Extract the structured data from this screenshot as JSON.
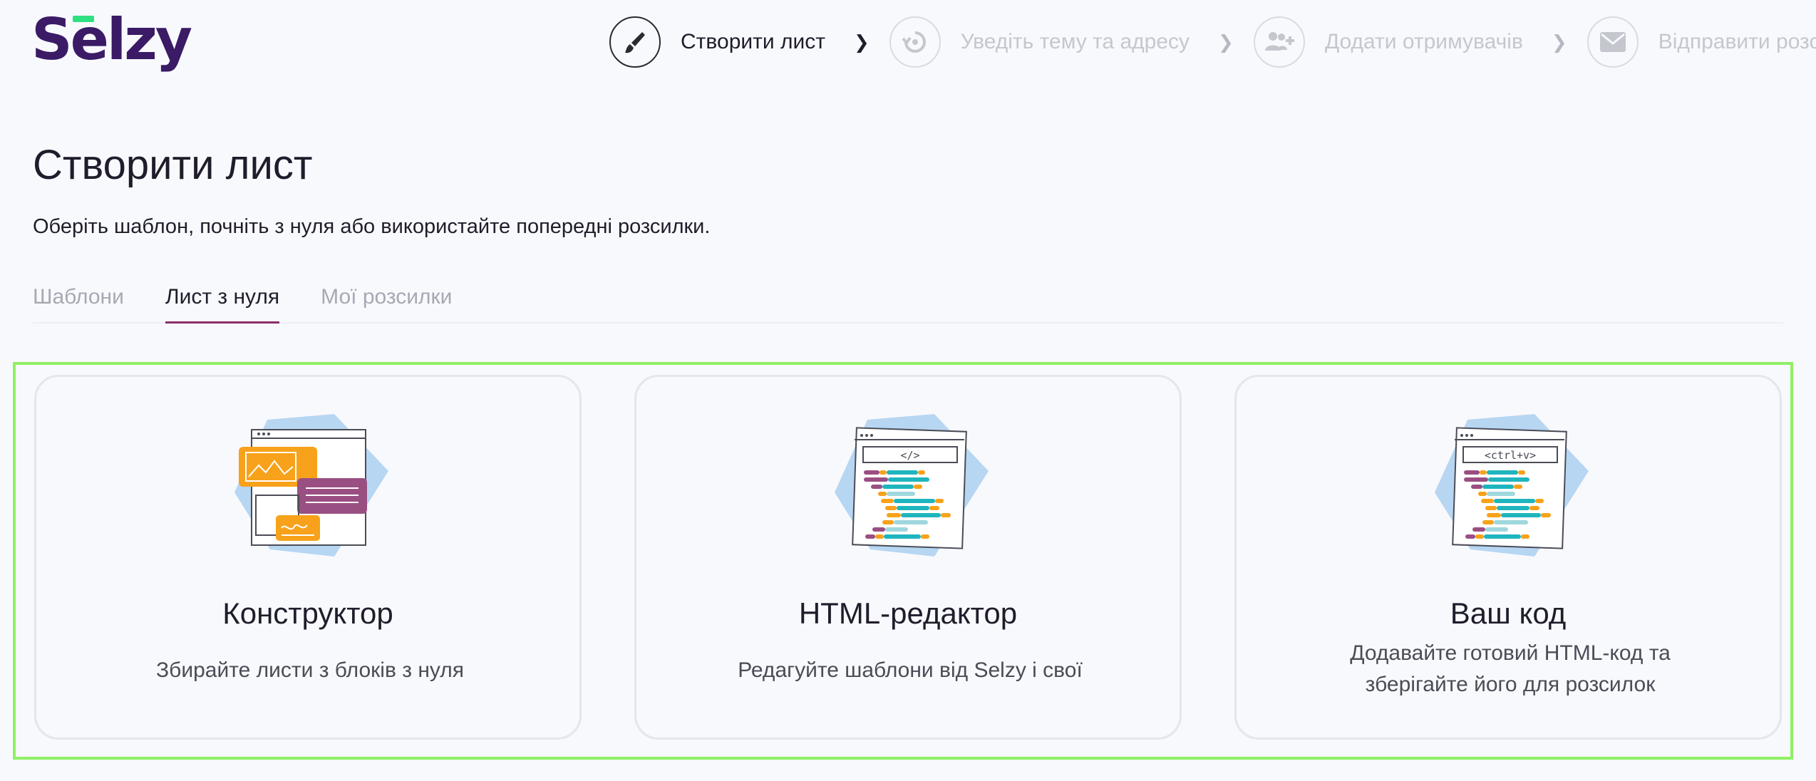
{
  "brand": {
    "logo_text": "Selzy",
    "accent": "#2fe082",
    "primary": "#3b1a66"
  },
  "steps": [
    {
      "label": "Створити лист",
      "icon": "brush-icon",
      "active": true
    },
    {
      "label": "Уведіть тему та адресу",
      "icon": "refresh-icon",
      "active": false
    },
    {
      "label": "Додати отримувачів",
      "icon": "add-users-icon",
      "active": false
    },
    {
      "label": "Відправити розсилку",
      "icon": "envelope-icon",
      "active": false
    }
  ],
  "page": {
    "title": "Створити лист",
    "subtitle": "Оберіть шаблон, почніть з нуля або використайте попередні розсилки."
  },
  "tabs": [
    {
      "label": "Шаблони",
      "active": false
    },
    {
      "label": "Лист з нуля",
      "active": true
    },
    {
      "label": "Мої розсилки",
      "active": false
    }
  ],
  "cards": [
    {
      "title": "Конструктор",
      "description": "Збирайте листи з блоків з нуля",
      "illustration": "constructor-illustration"
    },
    {
      "title": "HTML-редактор",
      "description": "Редагуйте шаблони від Selzy і свої",
      "illustration": "html-editor-illustration",
      "code_tag": "</>"
    },
    {
      "title": "Ваш код",
      "description": "Додавайте готовий HTML-код та зберігайте його для розсилок",
      "illustration": "paste-code-illustration",
      "code_tag": "<ctrl+v>"
    }
  ]
}
